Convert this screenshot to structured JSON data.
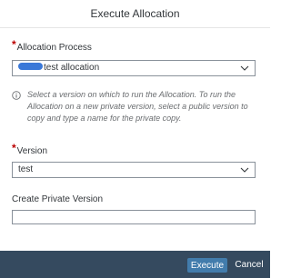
{
  "dialog": {
    "title": "Execute Allocation"
  },
  "allocation_process": {
    "label": "Allocation Process",
    "required": "*",
    "value": "test allocation"
  },
  "info": {
    "icon": "info-icon",
    "text": "Select a version on which to run the Allocation. To run the Allocation on a new private version, select a public version to copy and type a name for the private copy."
  },
  "version": {
    "label": "Version",
    "required": "*",
    "value": "test"
  },
  "private_version": {
    "label": "Create Private Version",
    "value": ""
  },
  "footer": {
    "execute_label": "Execute",
    "cancel_label": "Cancel"
  },
  "colors": {
    "footer_bg": "#354a5f",
    "primary_button": "#427cac",
    "required_marker": "#bb0000"
  }
}
